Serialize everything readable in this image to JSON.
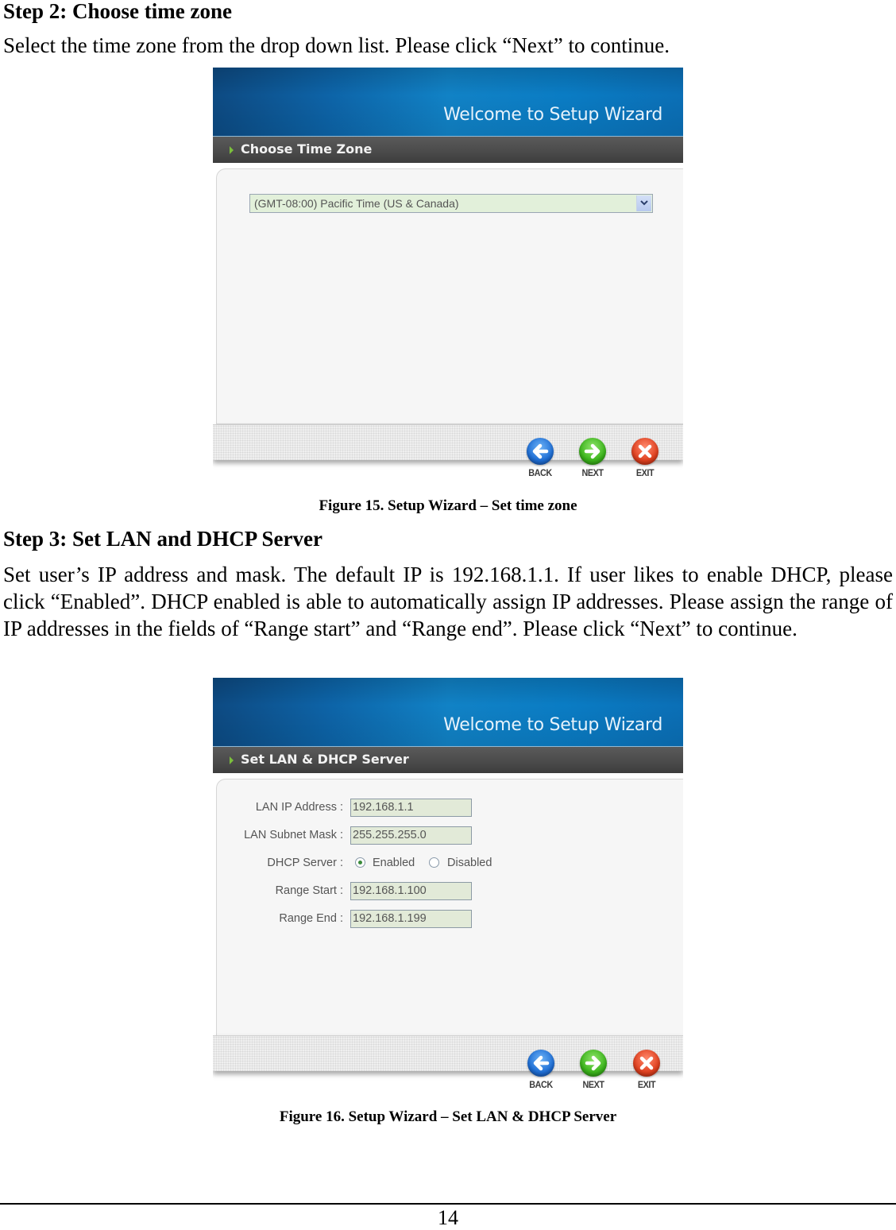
{
  "step2": {
    "title": "Step 2: Choose time zone",
    "text": "Select the time zone from the drop down list. Please click “Next” to continue."
  },
  "figure15": {
    "header_title": "Welcome to Setup Wizard",
    "section_label": "Choose Time Zone",
    "timezone_select": {
      "value": "(GMT-08:00) Pacific Time (US & Canada)"
    },
    "buttons": {
      "back": "BACK",
      "next": "NEXT",
      "exit": "EXIT"
    },
    "caption": "Figure 15. Setup Wizard – Set time zone"
  },
  "step3": {
    "title": "Step 3: Set LAN and DHCP Server",
    "text": "Set user’s IP address and mask. The default IP is 192.168.1.1. If user likes to enable DHCP, please click “Enabled”. DHCP enabled is able to automatically assign IP addresses. Please assign the range of IP addresses in the fields of “Range start” and “Range end”. Please click “Next” to continue."
  },
  "figure16": {
    "header_title": "Welcome to Setup Wizard",
    "section_label": "Set LAN & DHCP Server",
    "form": {
      "lan_ip": {
        "label": "LAN IP Address :",
        "value": "192.168.1.1"
      },
      "subnet": {
        "label": "LAN Subnet Mask :",
        "value": "255.255.255.0"
      },
      "dhcp": {
        "label": "DHCP Server :",
        "enabled_label": "Enabled",
        "disabled_label": "Disabled",
        "selected": "Enabled"
      },
      "range_start": {
        "label": "Range Start :",
        "value": "192.168.1.100"
      },
      "range_end": {
        "label": "Range End :",
        "value": "192.168.1.199"
      }
    },
    "buttons": {
      "back": "BACK",
      "next": "NEXT",
      "exit": "EXIT"
    },
    "caption": "Figure 16. Setup Wizard – Set LAN & DHCP Server"
  },
  "page_number": "14"
}
